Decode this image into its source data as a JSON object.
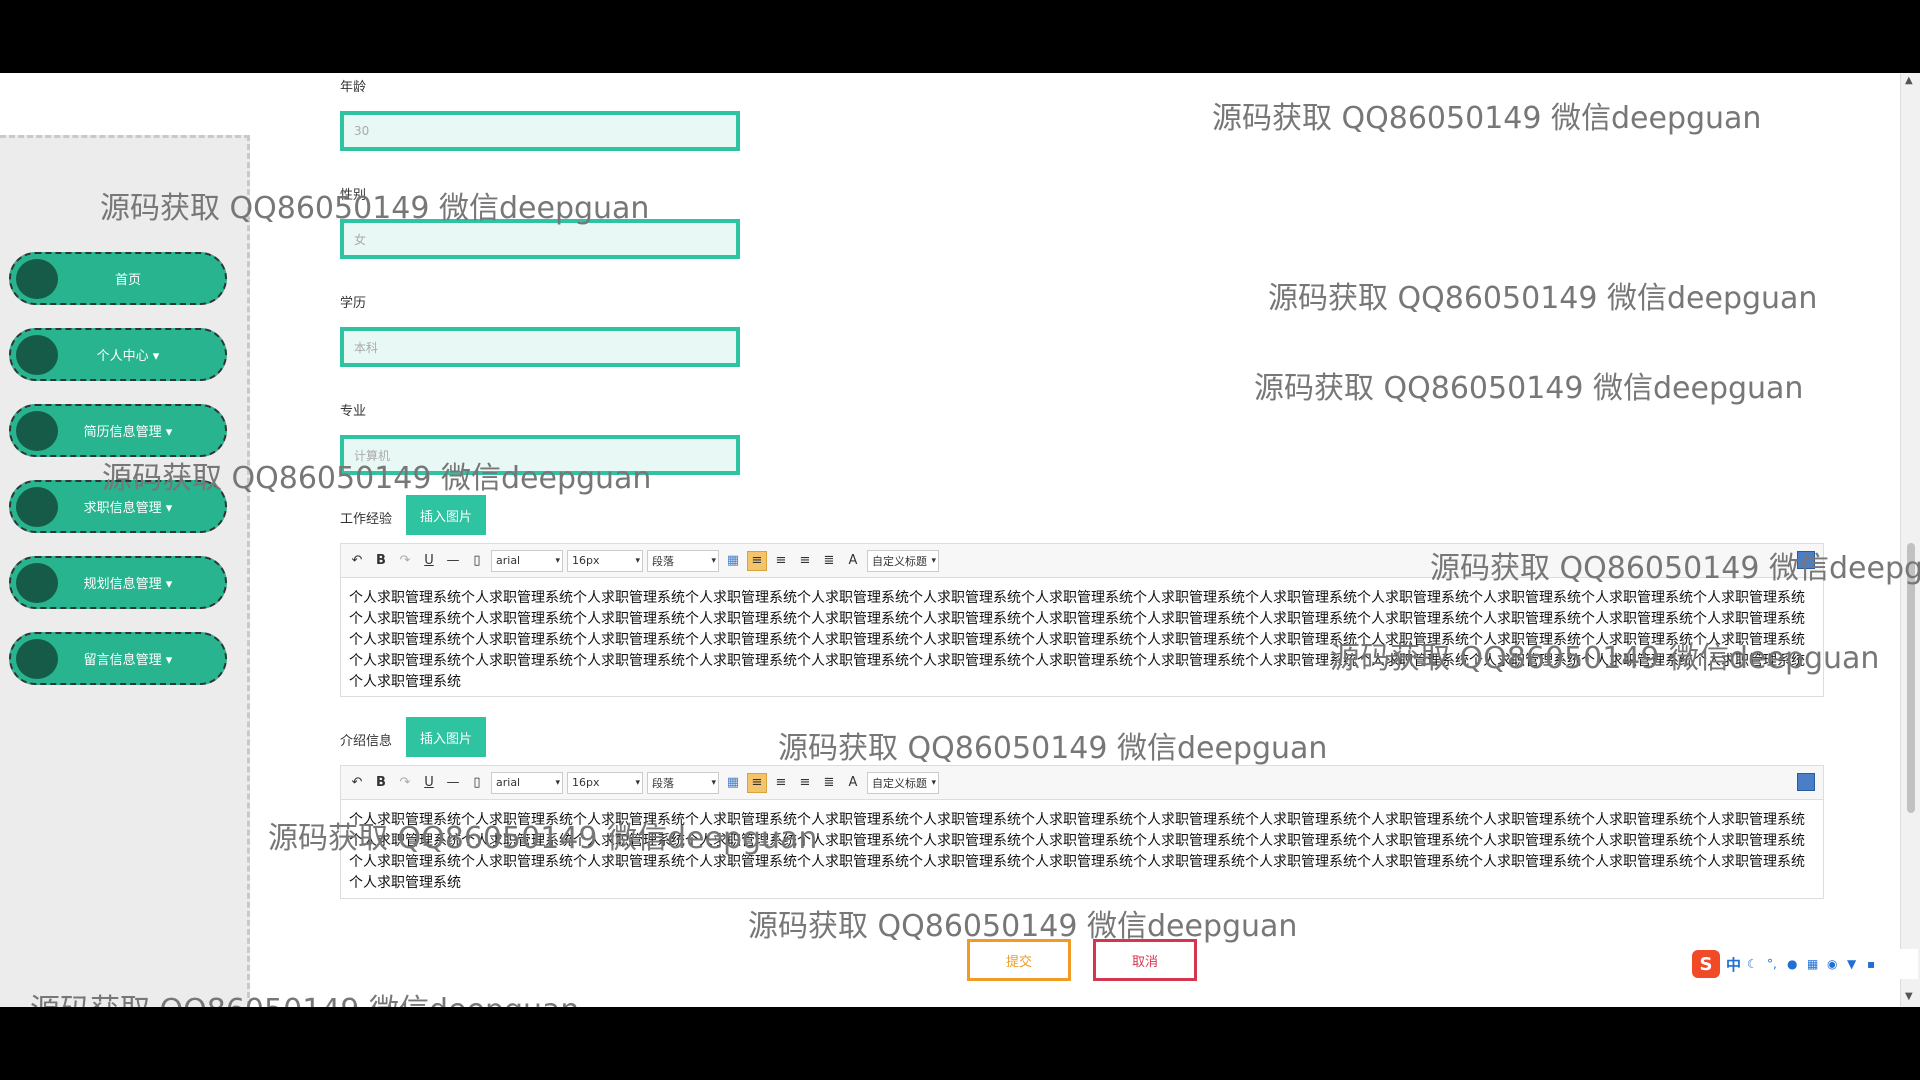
{
  "sidebar": {
    "items": [
      {
        "label": "首页"
      },
      {
        "label": "个人中心 ▾"
      },
      {
        "label": "简历信息管理 ▾"
      },
      {
        "label": "求职信息管理 ▾"
      },
      {
        "label": "规划信息管理 ▾"
      },
      {
        "label": "留言信息管理 ▾"
      }
    ]
  },
  "form": {
    "age": {
      "label": "年龄",
      "value": "30"
    },
    "gender": {
      "label": "性别",
      "value": "女"
    },
    "education": {
      "label": "学历",
      "value": "本科"
    },
    "major": {
      "label": "专业",
      "value": "计算机"
    },
    "work_experience": {
      "label": "工作经验",
      "insert_label": "插入图片"
    },
    "introduction": {
      "label": "介绍信息",
      "insert_label": "插入图片"
    }
  },
  "editor": {
    "undo_icon": "undo-icon",
    "bold": "B",
    "underline": "U",
    "hr": "—",
    "font": "arial",
    "size": "16px",
    "paragraph": "段落",
    "font_color": "A",
    "custom_title": "自定义标题"
  },
  "work_experience_text": "个人求职管理系统个人求职管理系统个人求职管理系统个人求职管理系统个人求职管理系统个人求职管理系统个人求职管理系统个人求职管理系统个人求职管理系统个人求职管理系统个人求职管理系统个人求职管理系统个人求职管理系统个人求职管理系统个人求职管理系统个人求职管理系统个人求职管理系统个人求职管理系统个人求职管理系统个人求职管理系统个人求职管理系统个人求职管理系统个人求职管理系统个人求职管理系统个人求职管理系统个人求职管理系统个人求职管理系统个人求职管理系统个人求职管理系统个人求职管理系统个人求职管理系统个人求职管理系统个人求职管理系统个人求职管理系统个人求职管理系统个人求职管理系统个人求职管理系统个人求职管理系统个人求职管理系统个人求职管理系统个人求职管理系统个人求职管理系统个人求职管理系统个人求职管理系统个人求职管理系统个人求职管理系统个人求职管理系统个人求职管理系统个人求职管理系统个人求职管理系统个人求职管理系统个人求职管理系统个人求职管理系统",
  "introduction_text": "个人求职管理系统个人求职管理系统个人求职管理系统个人求职管理系统个人求职管理系统个人求职管理系统个人求职管理系统个人求职管理系统个人求职管理系统个人求职管理系统个人求职管理系统个人求职管理系统个人求职管理系统个人求职管理系统个人求职管理系统个人求职管理系统个人求职管理系统个人求职管理系统个人求职管理系统个人求职管理系统个人求职管理系统个人求职管理系统个人求职管理系统个人求职管理系统个人求职管理系统个人求职管理系统个人求职管理系统个人求职管理系统个人求职管理系统个人求职管理系统个人求职管理系统个人求职管理系统个人求职管理系统个人求职管理系统个人求职管理系统个人求职管理系统个人求职管理系统个人求职管理系统个人求职管理系统个人求职管理系统",
  "actions": {
    "submit": "提交",
    "cancel": "取消"
  },
  "watermark": "源码获取 QQ86050149 微信deepguan",
  "watermark_cut": "源码获取 QQ86050149 微信deepgu",
  "ime": {
    "logo": "S",
    "mode": "中"
  },
  "colors": {
    "accent": "#2ec4a1",
    "submit": "#ef9b26",
    "cancel": "#d3364e"
  }
}
